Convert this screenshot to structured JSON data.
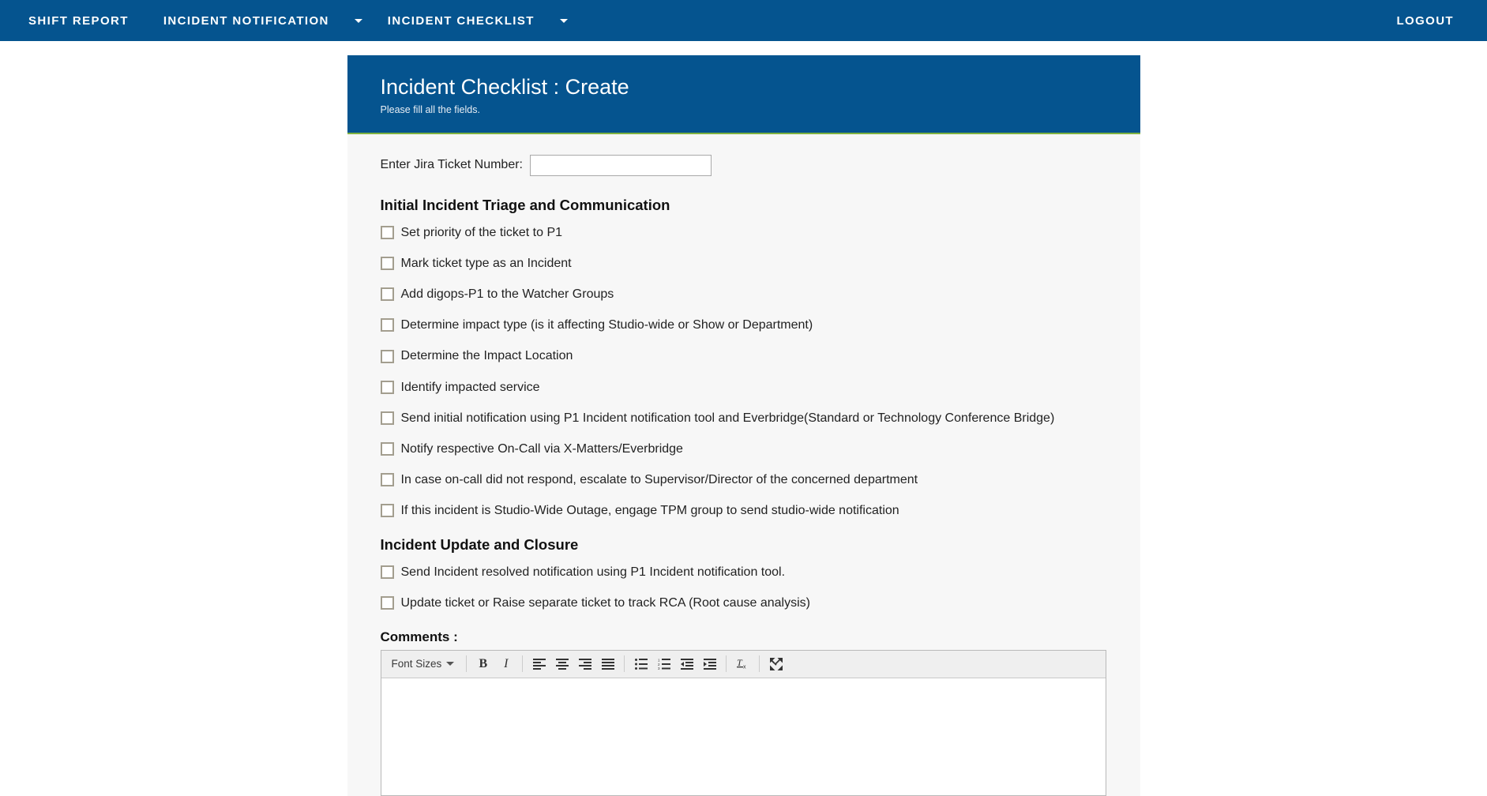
{
  "navbar": {
    "background_color": "#05548f",
    "left_items": [
      {
        "label": "Shift Report",
        "icon": "none",
        "has_caret": false
      },
      {
        "label": "Incident Notification",
        "icon": "chevron-down-icon",
        "has_caret": true
      },
      {
        "label": "Incident Checklist",
        "icon": "chevron-down-icon",
        "has_caret": true
      }
    ],
    "right_items": [
      {
        "label": "Logout"
      }
    ]
  },
  "panel": {
    "title": "Incident Checklist : Create",
    "subtitle": "Please fill all the fields.",
    "header_color": "#05548f",
    "accent_color": "#7fb241",
    "body_color": "#f7f7f7"
  },
  "ticket": {
    "label": "Enter Jira Ticket Number:",
    "value": "",
    "placeholder": ""
  },
  "sections": [
    {
      "heading": "Initial Incident Triage and Communication",
      "items": [
        {
          "label": "Set priority of the ticket to P1",
          "checked": false
        },
        {
          "label": "Mark ticket type as an Incident",
          "checked": false
        },
        {
          "label": "Add digops-P1 to the Watcher Groups",
          "checked": false
        },
        {
          "label": "Determine impact type (is it affecting Studio-wide or Show or Department)",
          "checked": false
        },
        {
          "label": "Determine the Impact Location",
          "checked": false
        },
        {
          "label": "Identify impacted service",
          "checked": false
        },
        {
          "label": "Send initial notification using P1 Incident notification tool and Everbridge(Standard or Technology Conference Bridge)",
          "checked": false
        },
        {
          "label": "Notify respective On-Call via X-Matters/Everbridge",
          "checked": false
        },
        {
          "label": "In case on-call did not respond, escalate to Supervisor/Director of the concerned department",
          "checked": false
        },
        {
          "label": "If this incident is Studio-Wide Outage, engage TPM group to send studio-wide notification",
          "checked": false
        }
      ]
    },
    {
      "heading": "Incident Update and Closure",
      "items": [
        {
          "label": "Send Incident resolved notification using P1 Incident notification tool.",
          "checked": false
        },
        {
          "label": "Update ticket or Raise separate ticket to track RCA (Root cause analysis)",
          "checked": false
        }
      ]
    }
  ],
  "comments": {
    "label": "Comments :",
    "value": "",
    "toolbar": {
      "font_sizes_label": "Font Sizes",
      "buttons": [
        {
          "name": "bold-icon",
          "label": "B"
        },
        {
          "name": "italic-icon",
          "label": "I"
        },
        {
          "name": "align-left-icon",
          "label": ""
        },
        {
          "name": "align-center-icon",
          "label": ""
        },
        {
          "name": "align-right-icon",
          "label": ""
        },
        {
          "name": "align-justify-icon",
          "label": ""
        },
        {
          "name": "bullet-list-icon",
          "label": ""
        },
        {
          "name": "numbered-list-icon",
          "label": ""
        },
        {
          "name": "outdent-icon",
          "label": ""
        },
        {
          "name": "indent-icon",
          "label": ""
        },
        {
          "name": "clear-formatting-icon",
          "label": ""
        },
        {
          "name": "fullscreen-icon",
          "label": ""
        }
      ]
    }
  }
}
